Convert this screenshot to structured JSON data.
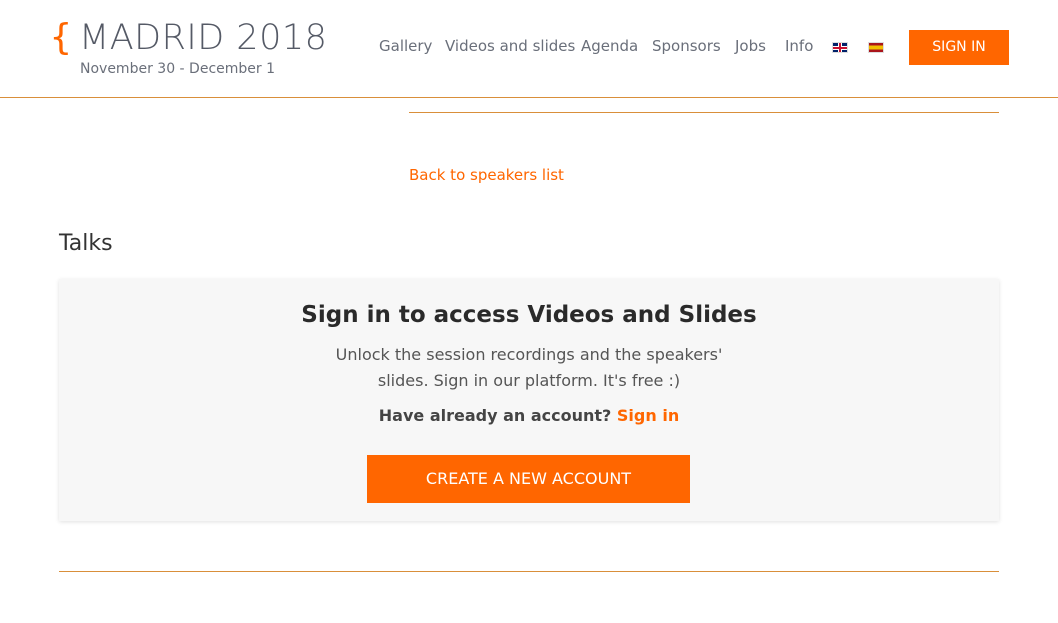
{
  "brand": {
    "brace": "{",
    "title": "MADRID 2018",
    "dates": "November 30 - December 1"
  },
  "nav": {
    "items": [
      {
        "label": "Gallery"
      },
      {
        "label": "Videos and slides"
      },
      {
        "label": "Agenda"
      },
      {
        "label": "Sponsors"
      },
      {
        "label": "Jobs"
      },
      {
        "label": "Info"
      }
    ],
    "flags": [
      "uk-flag-icon",
      "spain-flag-icon"
    ],
    "sign_in_label": "SIGN IN"
  },
  "main": {
    "back_link": "Back to speakers list",
    "talks_heading": "Talks",
    "card": {
      "title": "Sign in to access Videos and Slides",
      "description": "Unlock the session recordings and the speakers' slides. Sign in our platform. It's free :)",
      "account_prompt": "Have already an account?",
      "sign_in_link": "Sign in",
      "create_button": "CREATE A NEW ACCOUNT"
    }
  },
  "colors": {
    "accent": "#ff6600",
    "rule": "#d98f3a",
    "card_bg": "#f7f7f7"
  }
}
